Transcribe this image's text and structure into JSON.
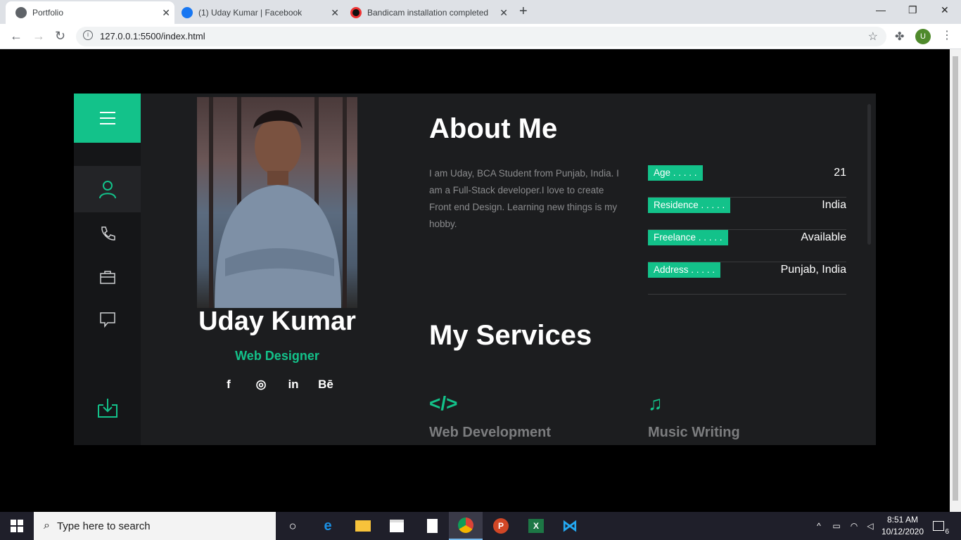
{
  "browser": {
    "tabs": [
      {
        "label": "Portfolio",
        "active": true
      },
      {
        "label": "(1) Uday Kumar | Facebook",
        "active": false
      },
      {
        "label": "Bandicam installation completed",
        "active": false
      }
    ],
    "url": "127.0.0.1:5500/index.html",
    "profile_initial": "U"
  },
  "sidebar": {
    "items": [
      "user-icon",
      "phone-icon",
      "briefcase-icon",
      "chat-icon",
      "download-icon"
    ],
    "accent": "#13c28a"
  },
  "profile": {
    "name": "Uday Kumar",
    "role": "Web Designer",
    "socials": [
      "f",
      "◎",
      "in",
      "Bē"
    ]
  },
  "about": {
    "heading": "About Me",
    "text": "I am Uday, BCA Student from Punjab, India. I am a Full-Stack developer.I love to create Front end Design. Learning new things is my hobby.",
    "info": [
      {
        "label": "Age . . . . .",
        "value": "21"
      },
      {
        "label": "Residence . . . . .",
        "value": "India"
      },
      {
        "label": "Freelance . . . . .",
        "value": "Available"
      },
      {
        "label": "Address . . . . .",
        "value": "Punjab, India"
      }
    ]
  },
  "services": {
    "heading": "My Services",
    "items": [
      {
        "icon": "</>",
        "title": "Web Development"
      },
      {
        "icon": "♫",
        "title": "Music Writing"
      }
    ]
  },
  "taskbar": {
    "search_placeholder": "Type here to search",
    "time": "8:51 AM",
    "date": "10/12/2020",
    "notifications": "6"
  }
}
